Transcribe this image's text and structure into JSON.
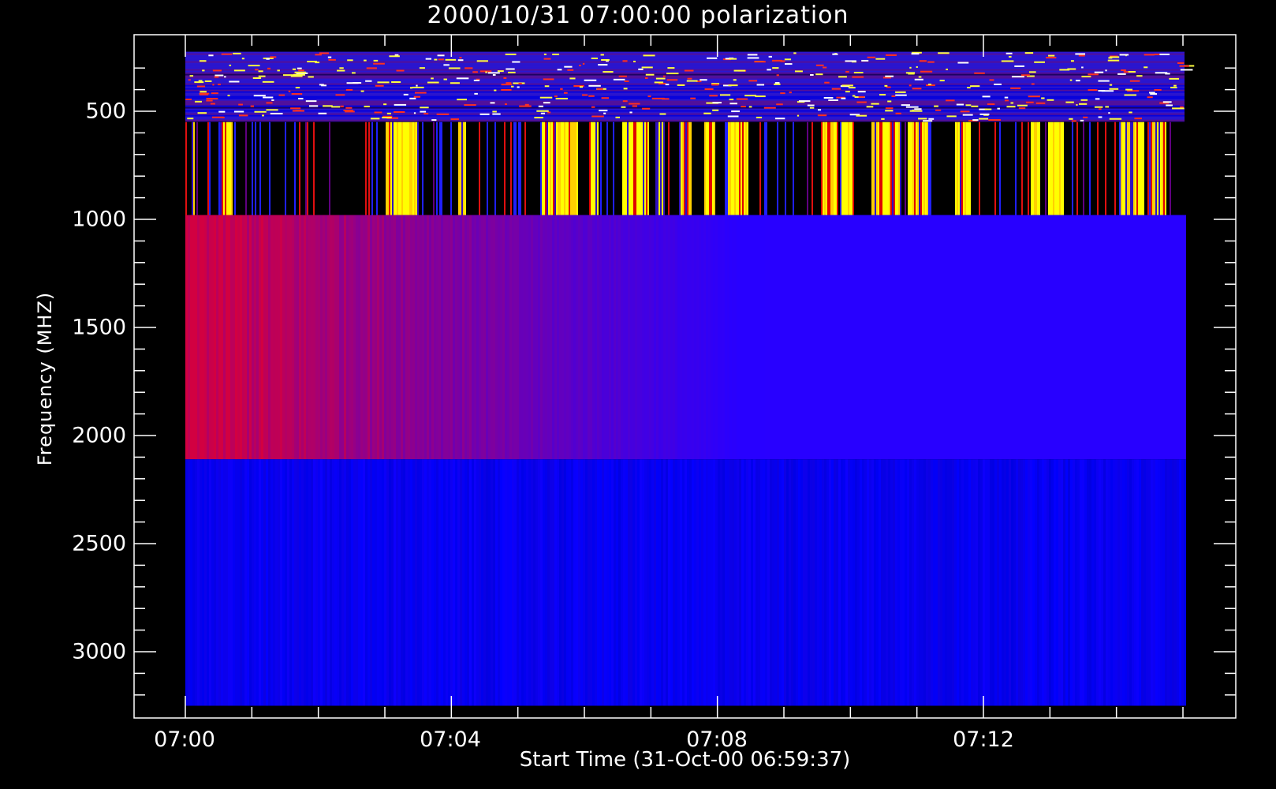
{
  "chart_data": {
    "type": "heatmap",
    "title": "2000/10/31 07:00:00 polarization",
    "xlabel": "Start Time (31-Oct-00 06:59:37)",
    "ylabel": "Frequency (MHZ)",
    "x_ticks": [
      "07:00",
      "07:04",
      "07:08",
      "07:12"
    ],
    "y_ticks": [
      "500",
      "1000",
      "1500",
      "2000",
      "2500",
      "3000"
    ],
    "x_range_minutes": [
      0,
      15
    ],
    "y_range_mhz": [
      3250,
      200
    ],
    "y_scale": "linear, frequency increasing downward",
    "colormap": [
      "#000000",
      "#0000ff",
      "#cc0000",
      "#ffff00"
    ],
    "bands": [
      {
        "freq_mhz": [
          225,
          550
        ],
        "pattern": "noisy horizontal streaks, blue with red/yellow speckles"
      },
      {
        "freq_mhz": [
          550,
          980
        ],
        "pattern": "vertical stripes, black with bright yellow bursts"
      },
      {
        "freq_mhz": [
          980,
          2110
        ],
        "pattern": "red-purple vertical striations fading to blue after ~07:08"
      },
      {
        "freq_mhz": [
          2110,
          3250
        ],
        "pattern": "uniform blue with faint vertical striations"
      }
    ]
  }
}
